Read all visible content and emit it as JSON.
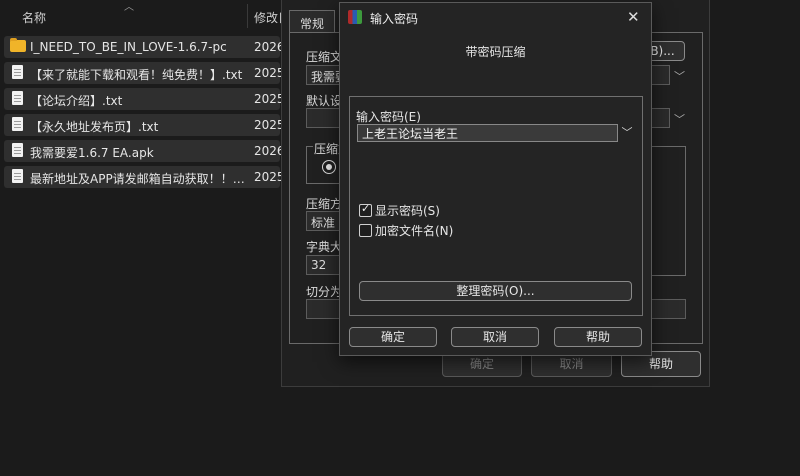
{
  "explorer": {
    "columns": {
      "name": "名称",
      "date": "修改日"
    },
    "rows": [
      {
        "icon": "folder-icon",
        "name": "I_NEED_TO_BE_IN_LOVE-1.6.7-pc",
        "date": "2026"
      },
      {
        "icon": "text-file-icon",
        "name": "【来了就能下载和观看！纯免费！】.txt",
        "date": "2025"
      },
      {
        "icon": "text-file-icon",
        "name": "【论坛介绍】.txt",
        "date": "2025"
      },
      {
        "icon": "text-file-icon",
        "name": "【永久地址发布页】.txt",
        "date": "2025"
      },
      {
        "icon": "file-icon",
        "name": "我需要爱1.6.7 EA.apk",
        "date": "2026"
      },
      {
        "icon": "text-file-icon",
        "name": "最新地址及APP请发邮箱自动获取！！！....",
        "date": "2025"
      }
    ]
  },
  "archive_dialog": {
    "tab_general": "常规",
    "archive_name_label": "压缩文",
    "archive_name_value": "我需要",
    "browse_button": "B)...",
    "default_label": "默认设",
    "format_group_label": "压缩文",
    "method_label": "压缩方",
    "method_value": "标准",
    "dict_label": "字典大",
    "dict_value": "32",
    "split_label": "切分为",
    "ok": "确定",
    "cancel": "取消",
    "help": "帮助"
  },
  "password_dialog": {
    "title": "输入密码",
    "subtitle": "带密码压缩",
    "input_label": "输入密码(E)",
    "input_value": "上老王论坛当老王",
    "show_password": {
      "label": "显示密码(S)",
      "checked": true
    },
    "encrypt_names": {
      "label": "加密文件名(N)",
      "checked": false
    },
    "organize_button": "整理密码(O)...",
    "ok": "确定",
    "cancel": "取消",
    "help": "帮助"
  }
}
